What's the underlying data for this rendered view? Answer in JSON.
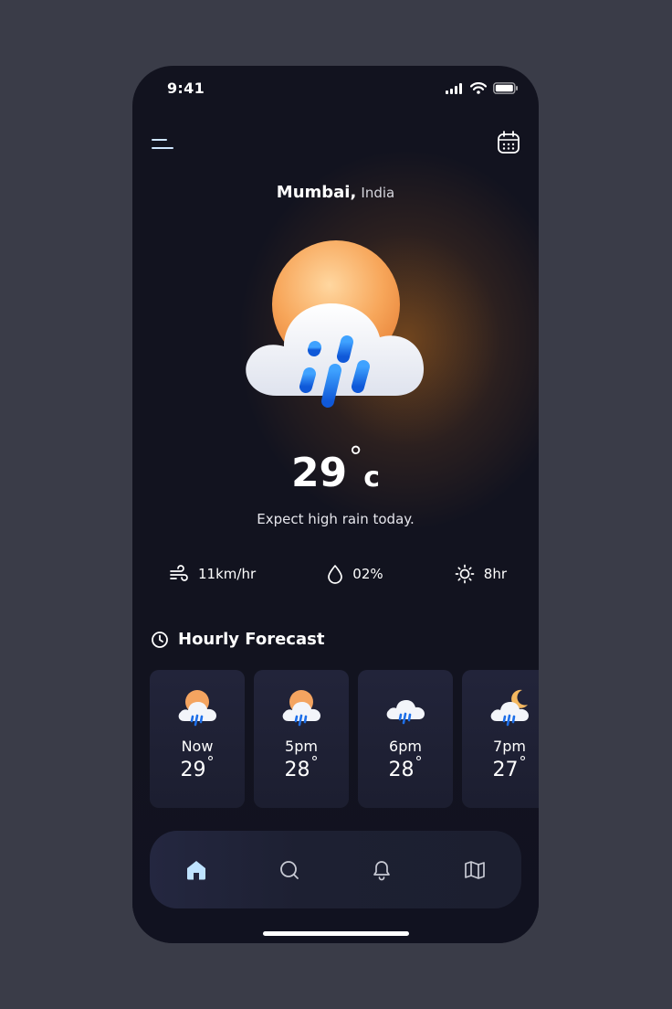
{
  "status_bar": {
    "time": "9:41"
  },
  "location": {
    "city": "Mumbai,",
    "country": "India"
  },
  "current": {
    "temperature": "29",
    "degree_symbol": "°",
    "unit": "c",
    "description": "Expect high rain today.",
    "icon": "sun-cloud-rain-icon"
  },
  "stats": [
    {
      "icon": "wind-icon",
      "value": "11km/hr"
    },
    {
      "icon": "droplet-icon",
      "value": "02%"
    },
    {
      "icon": "sun-icon",
      "value": "8hr"
    }
  ],
  "hourly": {
    "title": "Hourly Forecast",
    "items": [
      {
        "label": "Now",
        "temp": "29",
        "deg": "°",
        "icon": "sun-cloud-rain-icon"
      },
      {
        "label": "5pm",
        "temp": "28",
        "deg": "°",
        "icon": "sun-cloud-rain-icon"
      },
      {
        "label": "6pm",
        "temp": "28",
        "deg": "°",
        "icon": "cloud-rain-icon"
      },
      {
        "label": "7pm",
        "temp": "27",
        "deg": "°",
        "icon": "moon-cloud-rain-icon"
      }
    ]
  },
  "nav": [
    {
      "name": "home",
      "icon": "home-icon",
      "active": true
    },
    {
      "name": "search",
      "icon": "search-icon",
      "active": false
    },
    {
      "name": "notifications",
      "icon": "bell-icon",
      "active": false
    },
    {
      "name": "map",
      "icon": "map-icon",
      "active": false
    }
  ],
  "colors": {
    "background": "#3a3c48",
    "phone": "#12131f",
    "accent_glow": "#be6e1e",
    "rain_blue": "#1e6fe8",
    "active_nav": "#bfe3ff"
  }
}
